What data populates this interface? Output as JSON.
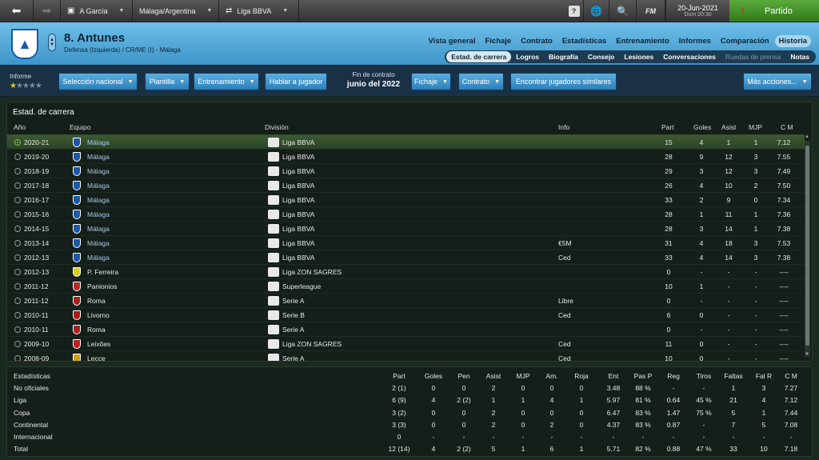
{
  "topbar": {
    "manager": "A García",
    "location": "Málaga/Argentina",
    "competition": "Liga BBVA",
    "date": "20-Jun-2021",
    "day_time": "Dom 20:30",
    "match_button": "Partido",
    "fm_label": "FM"
  },
  "player": {
    "name": "8. Antunes",
    "meta": "Defensa (Izquierda) / CR/ME (I) - Málaga"
  },
  "nav": {
    "main": [
      "Vista general",
      "Fichaje",
      "Contrato",
      "Estadísticas",
      "Entrenamiento",
      "Informes",
      "Comparación",
      "Historia"
    ],
    "sub": [
      "Estad. de carrera",
      "Logros",
      "Biografía",
      "Consejo",
      "Lesiones",
      "Conversaciones",
      "Ruedas de prensa",
      "Notas"
    ]
  },
  "actions": {
    "informe": "Informe",
    "seleccion": "Selección nacional",
    "plantilla": "Plantilla",
    "entrenamiento": "Entrenamiento",
    "hablar": "Hablar a jugador",
    "fin_contrato": "Fin de contrato",
    "fin_fecha": "junio del 2022",
    "fichaje": "Fichaje",
    "contrato": "Contrato",
    "similares": "Encontrar jugadores similares",
    "mas": "Más acciones..."
  },
  "career": {
    "title": "Estad. de carrera",
    "headers": {
      "year": "Año",
      "team": "Equipo",
      "division": "División",
      "info": "Info",
      "apps": "Part",
      "goals": "Goles",
      "assists": "Asist",
      "mom": "MJP",
      "rating": "C M"
    },
    "rows": [
      {
        "year": "2020-21",
        "team": "Málaga",
        "div": "Liga BBVA",
        "info": "",
        "apps": "15",
        "goals": "4",
        "ast": "1",
        "mjp": "1",
        "cm": "7.12",
        "color": "#1a58a8",
        "link": true
      },
      {
        "year": "2019-20",
        "team": "Málaga",
        "div": "Liga BBVA",
        "info": "",
        "apps": "28",
        "goals": "9",
        "ast": "12",
        "mjp": "3",
        "cm": "7.55",
        "color": "#1a58a8",
        "link": true
      },
      {
        "year": "2018-19",
        "team": "Málaga",
        "div": "Liga BBVA",
        "info": "",
        "apps": "29",
        "goals": "3",
        "ast": "12",
        "mjp": "3",
        "cm": "7.49",
        "color": "#1a58a8",
        "link": true
      },
      {
        "year": "2017-18",
        "team": "Málaga",
        "div": "Liga BBVA",
        "info": "",
        "apps": "26",
        "goals": "4",
        "ast": "10",
        "mjp": "2",
        "cm": "7.50",
        "color": "#1a58a8",
        "link": true
      },
      {
        "year": "2016-17",
        "team": "Málaga",
        "div": "Liga BBVA",
        "info": "",
        "apps": "33",
        "goals": "2",
        "ast": "9",
        "mjp": "0",
        "cm": "7.34",
        "color": "#1a58a8",
        "link": true
      },
      {
        "year": "2015-16",
        "team": "Málaga",
        "div": "Liga BBVA",
        "info": "",
        "apps": "28",
        "goals": "1",
        "ast": "11",
        "mjp": "1",
        "cm": "7.36",
        "color": "#1a58a8",
        "link": true
      },
      {
        "year": "2014-15",
        "team": "Málaga",
        "div": "Liga BBVA",
        "info": "",
        "apps": "28",
        "goals": "3",
        "ast": "14",
        "mjp": "1",
        "cm": "7.38",
        "color": "#1a58a8",
        "link": true
      },
      {
        "year": "2013-14",
        "team": "Málaga",
        "div": "Liga BBVA",
        "info": "€5M",
        "apps": "31",
        "goals": "4",
        "ast": "18",
        "mjp": "3",
        "cm": "7.53",
        "color": "#1a58a8",
        "link": true
      },
      {
        "year": "2012-13",
        "team": "Málaga",
        "div": "Liga BBVA",
        "info": "Ced",
        "apps": "33",
        "goals": "4",
        "ast": "14",
        "mjp": "3",
        "cm": "7.38",
        "color": "#1a58a8",
        "link": true
      },
      {
        "year": "2012-13",
        "team": "P. Ferreira",
        "div": "Liga ZON SAGRES",
        "info": "",
        "apps": "0",
        "goals": "-",
        "ast": "-",
        "mjp": "-",
        "cm": "----",
        "color": "#d8d020",
        "link": false
      },
      {
        "year": "2011-12",
        "team": "Panionios",
        "div": "Superleague",
        "info": "",
        "apps": "10",
        "goals": "1",
        "ast": "-",
        "mjp": "-",
        "cm": "----",
        "color": "#c02828",
        "link": false
      },
      {
        "year": "2011-12",
        "team": "Roma",
        "div": "Serie A",
        "info": "Libre",
        "apps": "0",
        "goals": "-",
        "ast": "-",
        "mjp": "-",
        "cm": "----",
        "color": "#a82020",
        "link": false
      },
      {
        "year": "2010-11",
        "team": "Livorno",
        "div": "Serie B",
        "info": "Ced",
        "apps": "6",
        "goals": "0",
        "ast": "-",
        "mjp": "-",
        "cm": "----",
        "color": "#b01818",
        "link": false
      },
      {
        "year": "2010-11",
        "team": "Roma",
        "div": "Serie A",
        "info": "",
        "apps": "0",
        "goals": "-",
        "ast": "-",
        "mjp": "-",
        "cm": "----",
        "color": "#a82020",
        "link": false
      },
      {
        "year": "2009-10",
        "team": "Leixões",
        "div": "Liga ZON SAGRES",
        "info": "Ced",
        "apps": "11",
        "goals": "0",
        "ast": "-",
        "mjp": "-",
        "cm": "----",
        "color": "#c02020",
        "link": false
      },
      {
        "year": "2008-09",
        "team": "Lecce",
        "div": "Serie A",
        "info": "Ced",
        "apps": "10",
        "goals": "0",
        "ast": "-",
        "mjp": "-",
        "cm": "----",
        "color": "#d0a010",
        "link": false
      }
    ]
  },
  "stats": {
    "headers": [
      "Estadísticas",
      "Part",
      "Goles",
      "Pen",
      "Asist",
      "MJP",
      "Am.",
      "Roja",
      "Ent",
      "Pas P",
      "Reg",
      "Tiros",
      "Faltas",
      "Fal R",
      "C M"
    ],
    "rows": [
      [
        "No oficiales",
        "2 (1)",
        "0",
        "0",
        "2",
        "0",
        "0",
        "0",
        "3.48",
        "88 %",
        "-",
        "-",
        "1",
        "3",
        "7.27"
      ],
      [
        "Liga",
        "6 (9)",
        "4",
        "2 (2)",
        "1",
        "1",
        "4",
        "1",
        "5.97",
        "81 %",
        "0.64",
        "45 %",
        "21",
        "4",
        "7.12"
      ],
      [
        "Copa",
        "3 (2)",
        "0",
        "0",
        "2",
        "0",
        "0",
        "0",
        "6.47",
        "83 %",
        "1.47",
        "75 %",
        "5",
        "1",
        "7.44"
      ],
      [
        "Continental",
        "3 (3)",
        "0",
        "0",
        "2",
        "0",
        "2",
        "0",
        "4.37",
        "83 %",
        "0.87",
        "-",
        "7",
        "5",
        "7.08"
      ],
      [
        "Internacional",
        "0",
        "-",
        "-",
        "-",
        "-",
        "-",
        "-",
        "-",
        "-",
        "-",
        "-",
        "-",
        "-",
        "-"
      ],
      [
        "Total",
        "12 (14)",
        "4",
        "2 (2)",
        "5",
        "1",
        "6",
        "1",
        "5.71",
        "82 %",
        "0.88",
        "47 %",
        "33",
        "10",
        "7.18"
      ]
    ]
  }
}
